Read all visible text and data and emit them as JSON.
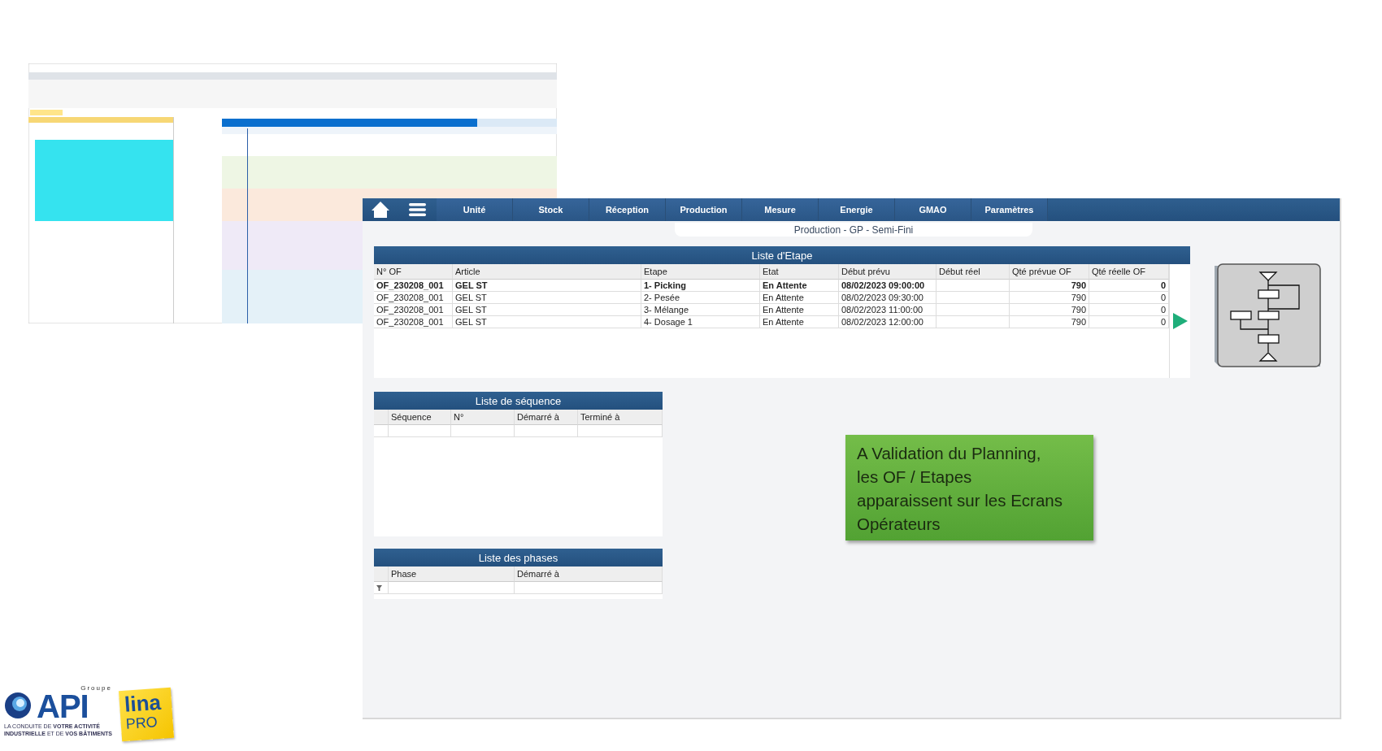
{
  "operator_screen": {
    "nav": [
      "Unité",
      "Stock",
      "Réception",
      "Production",
      "Mesure",
      "Energie",
      "GMAO",
      "Paramètres"
    ],
    "subtitle": "Production - GP - Semi-Fini",
    "steps": {
      "title": "Liste d'Etape",
      "columns": [
        "N° OF",
        "Article",
        "Etape",
        "Etat",
        "Début prévu",
        "Début réel",
        "Qté prévue OF",
        "Qté réelle OF"
      ],
      "rows": [
        {
          "cells": [
            "OF_230208_001",
            "GEL ST",
            "1- Picking",
            "En Attente",
            "08/02/2023 09:00:00",
            "",
            "790",
            "0"
          ],
          "active": true
        },
        {
          "cells": [
            "OF_230208_001",
            "GEL ST",
            "2- Pesée",
            "En Attente",
            "08/02/2023 09:30:00",
            "",
            "790",
            "0"
          ],
          "active": false
        },
        {
          "cells": [
            "OF_230208_001",
            "GEL ST",
            "3- Mélange",
            "En Attente",
            "08/02/2023 11:00:00",
            "",
            "790",
            "0"
          ],
          "active": false
        },
        {
          "cells": [
            "OF_230208_001",
            "GEL ST",
            "4- Dosage 1",
            "En Attente",
            "08/02/2023 12:00:00",
            "",
            "790",
            "0"
          ],
          "active": false
        }
      ]
    },
    "sequences": {
      "title": "Liste de séquence",
      "columns": [
        "Séquence",
        "N°",
        "Démarré à",
        "Terminé à"
      ]
    },
    "phases": {
      "title": "Liste des phases",
      "columns": [
        "Phase",
        "Démarré à"
      ]
    }
  },
  "note": {
    "lines": [
      "A Validation du Planning,",
      "les OF / Etapes",
      "apparaissent sur les Ecrans",
      "Opérateurs"
    ]
  },
  "logos": {
    "group": "Groupe",
    "api": "API",
    "tagline": "LA CONDUITE DE **VOTRE ACTIVITÉ**",
    "tagline_2": "**INDUSTRIELLE** ET DE **VOS BÂTIMENTS**",
    "lina": "lina",
    "pro": "PRO"
  }
}
